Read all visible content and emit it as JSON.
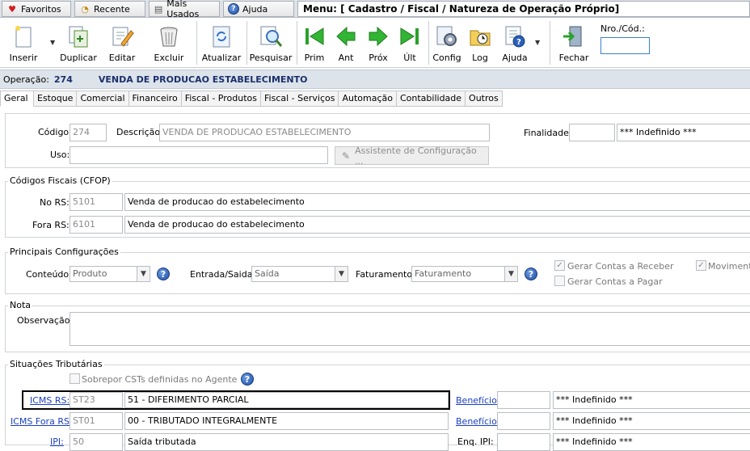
{
  "topbar": {
    "favoritos": "Favoritos",
    "recente": "Recente",
    "mais_usados": "Mais Usados",
    "ajuda": "Ajuda",
    "menu_title": "Menu: [ Cadastro / Fiscal / Natureza de Operação Próprio]"
  },
  "toolbar": {
    "inserir": "Inserir",
    "duplicar": "Duplicar",
    "editar": "Editar",
    "excluir": "Excluir",
    "atualizar": "Atualizar",
    "pesquisar": "Pesquisar",
    "prim": "Prim",
    "ant": "Ant",
    "prox": "Próx",
    "ult": "Últ",
    "config": "Config",
    "log": "Log",
    "ajuda": "Ajuda",
    "fechar": "Fechar",
    "nro_label": "Nro./Cód.:",
    "nro_value": ""
  },
  "operation": {
    "label": "Operação:",
    "code": "274",
    "name": "VENDA DE PRODUCAO ESTABELECIMENTO"
  },
  "tabs": [
    "Geral",
    "Estoque",
    "Comercial",
    "Financeiro",
    "Fiscal - Produtos",
    "Fiscal - Serviços",
    "Automação",
    "Contabilidade",
    "Outros"
  ],
  "geral": {
    "codigo_label": "Código:",
    "codigo_value": "274",
    "descricao_label": "Descrição:",
    "descricao_value": "VENDA DE PRODUCAO ESTABELECIMENTO",
    "finalidade_label": "Finalidade:",
    "finalidade_code": "",
    "finalidade_desc": "*** Indefinido ***",
    "uso_label": "Uso:",
    "uso_value": "",
    "assistente_label": "Assistente de Configuração ..."
  },
  "cfop": {
    "title": "Códigos Fiscais (CFOP)",
    "no_rs_label": "No RS:",
    "no_rs_code": "5101",
    "no_rs_desc": "Venda de producao do estabelecimento",
    "fora_rs_label": "Fora RS:",
    "fora_rs_code": "6101",
    "fora_rs_desc": "Venda de producao do estabelecimento"
  },
  "config": {
    "title": "Principais Configurações",
    "conteudo_label": "Conteúdo:",
    "conteudo_value": "Produto",
    "entrada_label": "Entrada/Saida:",
    "entrada_value": "Saída",
    "faturamento_label": "Faturamento:",
    "faturamento_value": "Faturamento",
    "gerar_receber": "Gerar Contas a Receber",
    "gerar_pagar": "Gerar Contas a Pagar",
    "movimento": "Moviment"
  },
  "nota": {
    "title": "Nota",
    "observacao_label": "Observação:",
    "observacao_value": ""
  },
  "situacoes": {
    "title": "Situações Tributárias",
    "sobrepor_label": "Sobrepor CSTs definidas no Agente",
    "rows": [
      {
        "label": "ICMS RS:",
        "code": "ST23",
        "desc": "51 - DIFERIMENTO PARCIAL",
        "beneficio_label": "Benefício:",
        "beneficio_code": "",
        "beneficio_desc": "*** Indefinido ***"
      },
      {
        "label": "ICMS Fora RS:",
        "code": "ST01",
        "desc": "00 - TRIBUTADO INTEGRALMENTE",
        "beneficio_label": "Benefício:",
        "beneficio_code": "",
        "beneficio_desc": "*** Indefinido ***"
      },
      {
        "label": "IPI:",
        "code": "50",
        "desc": "Saída tributada",
        "beneficio_label": "Enq. IPI:",
        "beneficio_code": "",
        "beneficio_desc": "*** Indefinido ***"
      }
    ]
  }
}
